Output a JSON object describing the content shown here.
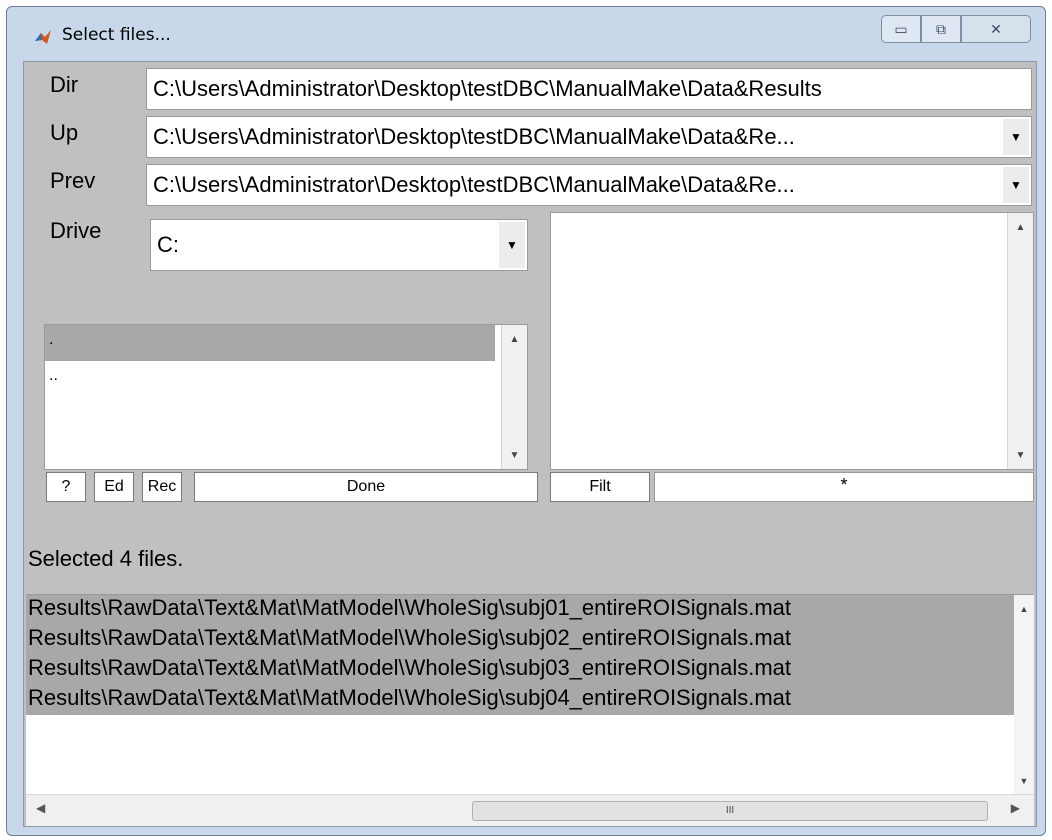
{
  "window": {
    "title": "Select files...",
    "minimize_glyph": "▭",
    "maximize_glyph": "⧉",
    "close_glyph": "✕"
  },
  "rows": {
    "dir": {
      "label": "Dir",
      "value": "C:\\Users\\Administrator\\Desktop\\testDBC\\ManualMake\\Data&Results"
    },
    "up": {
      "label": "Up",
      "value": "C:\\Users\\Administrator\\Desktop\\testDBC\\ManualMake\\Data&Re..."
    },
    "prev": {
      "label": "Prev",
      "value": "C:\\Users\\Administrator\\Desktop\\testDBC\\ManualMake\\Data&Re..."
    },
    "drive": {
      "label": "Drive",
      "value": "C:"
    }
  },
  "dir_list": {
    "items": [
      ".",
      ".."
    ]
  },
  "buttons": {
    "help": "?",
    "edit": "Ed",
    "rec": "Rec",
    "done": "Done",
    "filter": "Filt"
  },
  "filter_value": "*",
  "status": "Selected 4 files.",
  "selected_files": [
    "Results\\RawData\\Text&Mat\\MatModel\\WholeSig\\subj01_entireROISignals.mat",
    "Results\\RawData\\Text&Mat\\MatModel\\WholeSig\\subj02_entireROISignals.mat",
    "Results\\RawData\\Text&Mat\\MatModel\\WholeSig\\subj03_entireROISignals.mat",
    "Results\\RawData\\Text&Mat\\MatModel\\WholeSig\\subj04_entireROISignals.mat"
  ],
  "hscroll_thumb_glyph": "III",
  "colors": {
    "selection": "#a8a8a8",
    "panel": "#c0c0c0",
    "frame": "#c8d8ea"
  }
}
